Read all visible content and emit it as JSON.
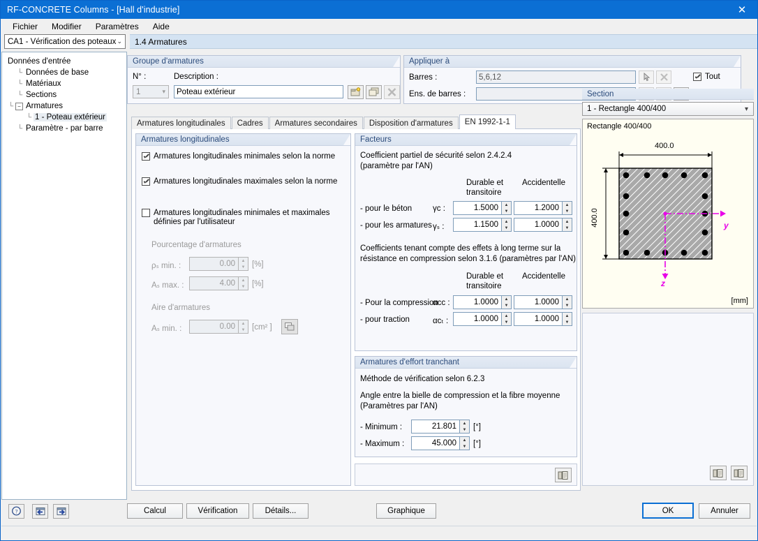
{
  "window": {
    "title": "RF-CONCRETE Columns - [Hall d'industrie]",
    "close_label": "✕"
  },
  "menu": {
    "items": [
      {
        "label": "Fichier"
      },
      {
        "label": "Modifier"
      },
      {
        "label": "Paramètres"
      },
      {
        "label": "Aide"
      }
    ]
  },
  "nav": {
    "combo_value": "CA1 - Vérification des poteaux",
    "chevron": "⌄",
    "page_title": "1.4 Armatures"
  },
  "tree": {
    "root": "Données d'entrée",
    "items": [
      {
        "label": "Données de base",
        "selected": false
      },
      {
        "label": "Matériaux",
        "selected": false
      },
      {
        "label": "Sections",
        "selected": false
      },
      {
        "label": "Armatures",
        "selected": false,
        "expander": "−"
      },
      {
        "label": "1 - Poteau extérieur",
        "selected": true
      },
      {
        "label": "Paramètre - par barre",
        "selected": false
      }
    ]
  },
  "reinf_group": {
    "title": "Groupe d'armatures",
    "no_label": "N° :",
    "no_value": "1",
    "desc_label": "Description :",
    "desc_value": "Poteau extérieur",
    "buttons": [
      {
        "name": "new-group-icon"
      },
      {
        "name": "copy-group-icon"
      },
      {
        "name": "delete-group-icon"
      }
    ]
  },
  "apply_to": {
    "title": "Appliquer à",
    "bars_label": "Barres :",
    "bars_value": "5,6,12",
    "barsets_label": "Ens. de barres :",
    "barsets_value": "",
    "all_label_1": "Tout",
    "all_label_2": "Tout",
    "all_checked_1": true,
    "all_checked_2": true
  },
  "tabs": [
    {
      "label": "Armatures longitudinales",
      "active": false
    },
    {
      "label": "Cadres",
      "active": false
    },
    {
      "label": "Armatures secondaires",
      "active": false
    },
    {
      "label": "Disposition d'armatures",
      "active": false
    },
    {
      "label": "EN 1992-1-1",
      "active": true
    }
  ],
  "longitudinal": {
    "title": "Armatures longitudinales",
    "check_min_norm": {
      "label": "Armatures longitudinales minimales selon la norme",
      "checked": true
    },
    "check_max_norm": {
      "label": "Armatures longitudinales maximales selon la norme",
      "checked": true
    },
    "check_user": {
      "label": "Armatures longitudinales minimales et maximales définies par l'utilisateur",
      "checked": false
    },
    "percent_header": "Pourcentage d'armatures",
    "rho_min_label": "ρₛ min. :",
    "rho_min_value": "0.00",
    "rho_min_unit": "[%]",
    "as_max_label": "Aₛ max. :",
    "as_max_value": "4.00",
    "as_max_unit": "[%]",
    "area_header": "Aire d'armatures",
    "as_min_label": "Aₛ min. :",
    "as_min_value": "0.00",
    "as_min_unit": "[cm² ]"
  },
  "factors": {
    "title": "Facteurs",
    "intro_line1": "Coefficient partiel de sécurité selon 2.4.2.4",
    "intro_line2": "(paramètre par l'AN)",
    "col_durable_l1": "Durable et",
    "col_durable_l2": "transitoire",
    "col_accidental": "Accidentelle",
    "rows": [
      {
        "label": "- pour le béton",
        "symbol": "γᴄ :",
        "durable": "1.5000",
        "accidental": "1.2000"
      },
      {
        "label": "- pour les armatures",
        "symbol": "γₛ :",
        "durable": "1.1500",
        "accidental": "1.0000"
      }
    ],
    "intro2_line1": "Coefficients tenant compte des effets à long terme sur la",
    "intro2_line2": "résistance en compression selon 3.1.6 (paramètres par l'AN)",
    "col2_durable_l1": "Durable et",
    "col2_durable_l2": "transitoire",
    "col2_accidental": "Accidentelle",
    "rows2": [
      {
        "label": "- Pour la compression",
        "symbol": "αᴄᴄ :",
        "durable": "1.0000",
        "accidental": "1.0000"
      },
      {
        "label": "- pour traction",
        "symbol": "αᴄₜ :",
        "durable": "1.0000",
        "accidental": "1.0000"
      }
    ]
  },
  "shear": {
    "title": "Armatures d'effort tranchant",
    "line1": "Méthode de vérification selon 6.2.3",
    "line2": "Angle entre la bielle de compression et la fibre moyenne",
    "line3": "(Paramètres par l'AN)",
    "min_label": "- Minimum :",
    "min_value": "21.801",
    "min_unit": "[°]",
    "max_label": "- Maximum :",
    "max_value": "45.000",
    "max_unit": "[°]"
  },
  "section": {
    "title": "Section",
    "combo_value": "1 - Rectangle 400/400",
    "chevron": "⌄",
    "caption": "Rectangle 400/400",
    "unit": "[mm]",
    "dim_top": "400.0",
    "dim_left": "400.0",
    "axis_y": "y",
    "axis_z": "z",
    "bar_count": 16,
    "accent_axis_color": "#e800e8",
    "hatch_color": "#a9a9a9"
  },
  "bottom": {
    "help_icon": "help-icon",
    "prev_icon": "previous-page-icon",
    "next_icon": "next-page-icon",
    "calcul": "Calcul",
    "verification": "Vérification",
    "details": "Détails...",
    "graphique": "Graphique",
    "ok": "OK",
    "annuler": "Annuler"
  }
}
